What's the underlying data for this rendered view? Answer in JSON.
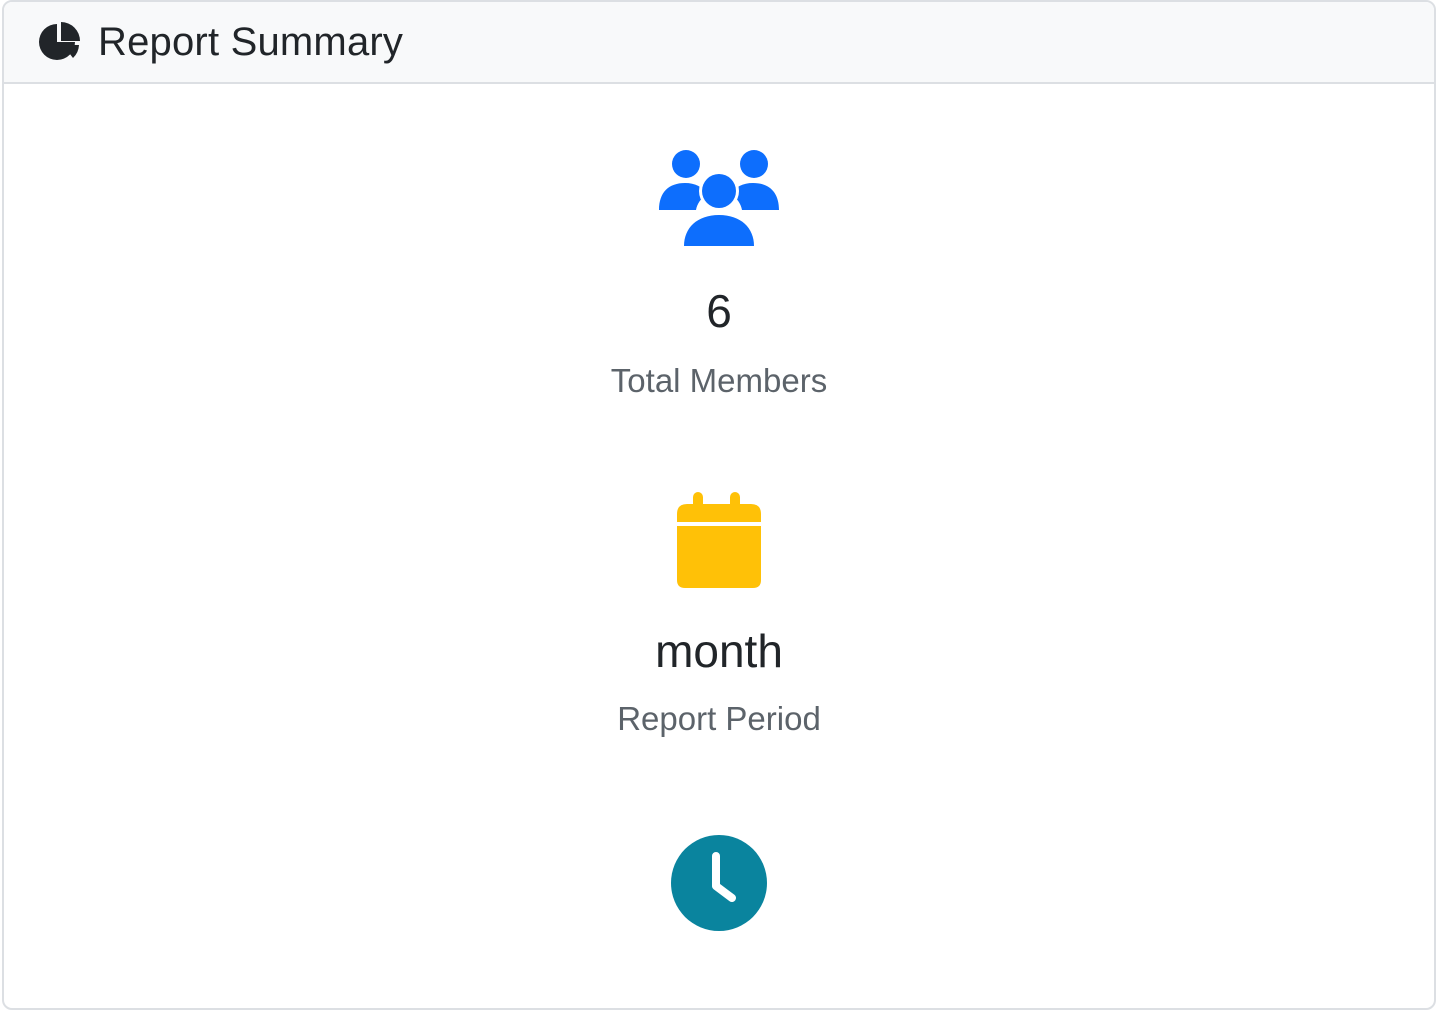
{
  "header": {
    "title": "Report Summary",
    "icon": "pie-chart-icon"
  },
  "stats": [
    {
      "icon": "people-icon",
      "icon_color": "#0d6efd",
      "value": "6",
      "label": "Total Members"
    },
    {
      "icon": "calendar-icon",
      "icon_color": "#ffc107",
      "value": "month",
      "label": "Report Period"
    },
    {
      "icon": "clock-icon",
      "icon_color": "#0a849e"
    }
  ]
}
